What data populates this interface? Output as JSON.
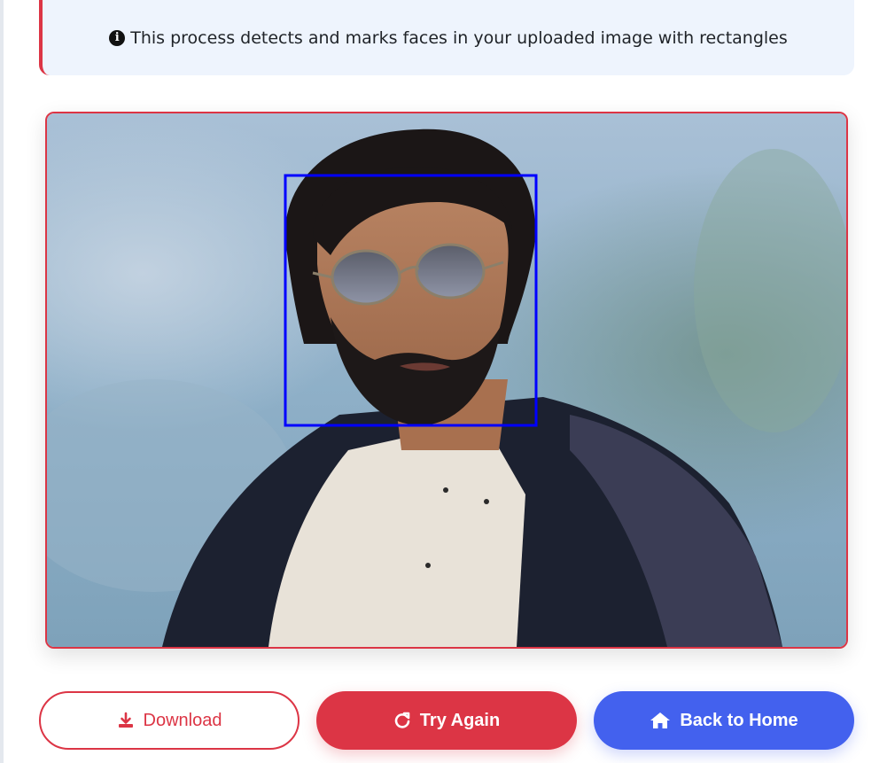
{
  "info_banner": {
    "icon": "info-circle-icon",
    "text": "This process detects and marks faces in your uploaded image with rectangles"
  },
  "result_image": {
    "detected_faces": 1,
    "box_color": "#0000ff"
  },
  "buttons": {
    "download": {
      "label": "Download",
      "icon": "download-icon"
    },
    "try_again": {
      "label": "Try Again",
      "icon": "redo-icon"
    },
    "back_home": {
      "label": "Back to Home",
      "icon": "home-icon"
    }
  },
  "colors": {
    "accent_red": "#dc3545",
    "accent_blue": "#4361ee",
    "banner_bg": "#eef4fd"
  }
}
